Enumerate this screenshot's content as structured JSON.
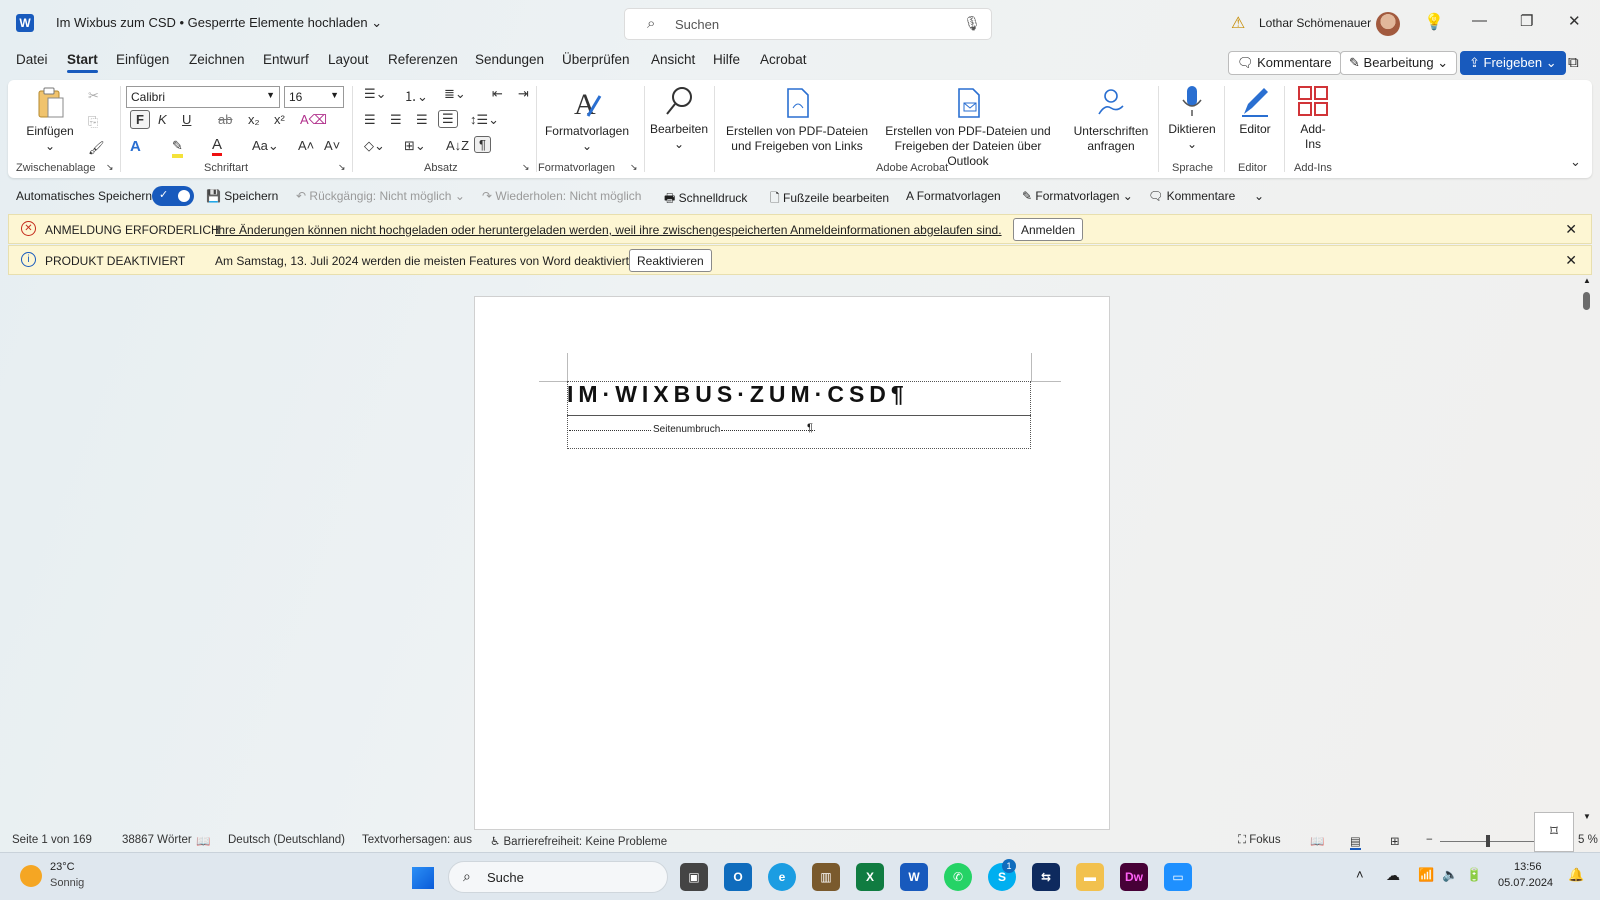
{
  "titlebar": {
    "app_icon": "W",
    "doc_title": "Im Wixbus zum CSD • Gesperrte Elemente hochladen",
    "search_placeholder": "Suchen",
    "user_name": "Lothar Schömenauer"
  },
  "menu": [
    "Datei",
    "Start",
    "Einfügen",
    "Zeichnen",
    "Entwurf",
    "Layout",
    "Referenzen",
    "Sendungen",
    "Überprüfen",
    "Ansicht",
    "Hilfe",
    "Acrobat"
  ],
  "menu_active": "Start",
  "top_buttons": {
    "comments": "Kommentare",
    "editing": "Bearbeitung",
    "share": "Freigeben"
  },
  "ribbon": {
    "paste": "Einfügen",
    "font_name": "Calibri",
    "font_size": "16",
    "bold": "F",
    "italic": "K",
    "underline": "U",
    "styles": "Formatvorlagen",
    "edit": "Bearbeiten",
    "pdf_links": [
      "Erstellen von PDF-Dateien",
      "und Freigeben von Links"
    ],
    "pdf_outlook": [
      "Erstellen von PDF-Dateien und",
      "Freigeben der Dateien über Outlook"
    ],
    "signatures": [
      "Unterschriften",
      "anfragen"
    ],
    "dictate": "Diktieren",
    "editor": "Editor",
    "addins": [
      "Add-",
      "Ins"
    ],
    "groups": {
      "clipboard": "Zwischenablage",
      "font": "Schriftart",
      "paragraph": "Absatz",
      "styles": "Formatvorlagen",
      "acrobat": "Adobe Acrobat",
      "voice": "Sprache",
      "editor": "Editor",
      "addins": "Add-Ins"
    }
  },
  "qat": {
    "autosave": "Automatisches Speichern",
    "save": "Speichern",
    "undo": "Rückgängig: Nicht möglich",
    "redo": "Wiederholen: Nicht möglich",
    "quickprint": "Schnelldruck",
    "footer": "Fußzeile bearbeiten",
    "styles1": "Formatvorlagen",
    "styles2": "Formatvorlagen",
    "comments": "Kommentare"
  },
  "messages": {
    "signin": {
      "title": "ANMELDUNG ERFORDERLICH",
      "text": "Ihre Änderungen können nicht hochgeladen oder heruntergeladen werden, weil ihre zwischengespeicherten Anmeldeinformationen abgelaufen sind.",
      "action": "Anmelden"
    },
    "product": {
      "title": "PRODUKT DEAKTIVIERT",
      "text": "Am Samstag, 13. Juli 2024 werden die meisten Features von Word deaktiviert.",
      "action": "Reaktivieren"
    }
  },
  "document": {
    "heading": "IM·WIXBUS·ZUM·CSD¶",
    "page_break": "Seitenumbruch",
    "pilcrow": "¶"
  },
  "statusbar": {
    "page": "Seite 1 von 169",
    "words": "38867 Wörter",
    "language": "Deutsch (Deutschland)",
    "prediction": "Textvorhersagen: aus",
    "accessibility": "Barrierefreiheit: Keine Probleme",
    "focus": "Fokus",
    "zoom": "5 %"
  },
  "taskbar": {
    "temp": "23°C",
    "weather": "Sonnig",
    "search": "Suche",
    "time": "13:56",
    "date": "05.07.2024",
    "skype_badge": "1"
  }
}
